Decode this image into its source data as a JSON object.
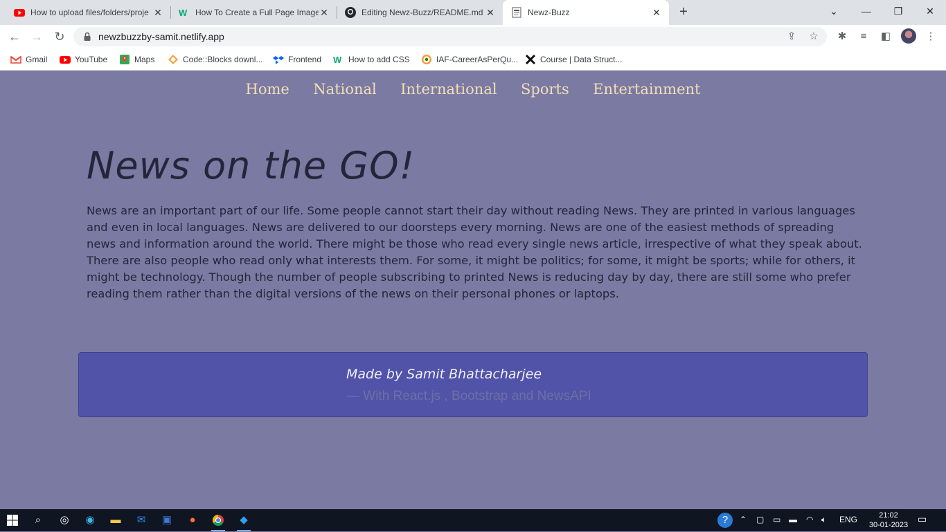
{
  "browser": {
    "tabs": [
      {
        "title": "How to upload files/folders/proje",
        "icon": "youtube-icon",
        "active": false
      },
      {
        "title": "How To Create a Full Page Image",
        "icon": "w3-icon",
        "active": false
      },
      {
        "title": "Editing Newz-Buzz/README.md",
        "icon": "github-icon",
        "active": false
      },
      {
        "title": "Newz-Buzz",
        "icon": "page-icon",
        "active": true
      }
    ],
    "url": "newzbuzzby-samit.netlify.app",
    "bookmarks": [
      {
        "label": "Gmail",
        "icon": "gmail-icon"
      },
      {
        "label": "YouTube",
        "icon": "youtube-icon"
      },
      {
        "label": "Maps",
        "icon": "maps-icon"
      },
      {
        "label": "Code::Blocks downl...",
        "icon": "codeblocks-icon"
      },
      {
        "label": "Frontend",
        "icon": "dropbox-icon"
      },
      {
        "label": "How to add CSS",
        "icon": "w3-icon"
      },
      {
        "label": "IAF-CareerAsPerQu...",
        "icon": "iaf-icon"
      },
      {
        "label": "Course | Data Struct...",
        "icon": "x-icon"
      }
    ]
  },
  "site": {
    "nav": [
      "Home",
      "National",
      "International",
      "Sports",
      "Entertainment"
    ],
    "hero_title": "News on the GO!",
    "intro": "News are an important part of our life. Some people cannot start their day without reading News. They are printed in various languages and even in local languages. News are delivered to our doorsteps every morning. News are one of the easiest methods of spreading news and information around the world. There might be those who read every single news article, irrespective of what they speak about. There are also people who read only what interests them. For some, it might be politics; for some, it might be sports; while for others, it might be technology. Though the number of people subscribing to printed News is reducing day by day, there are still some who prefer reading them rather than the digital versions of the news on their personal phones or laptops.",
    "footer_made": "Made by Samit Bhattacharjee",
    "footer_with": "— With React.js , Bootstrap and NewsAPI"
  },
  "taskbar": {
    "lang": "ENG",
    "time": "21:02",
    "date": "30-01-2023"
  },
  "colors": {
    "page_bg": "#7b7aa3",
    "nav_text": "#f3dfb6",
    "footer_bg": "#5153a8"
  }
}
